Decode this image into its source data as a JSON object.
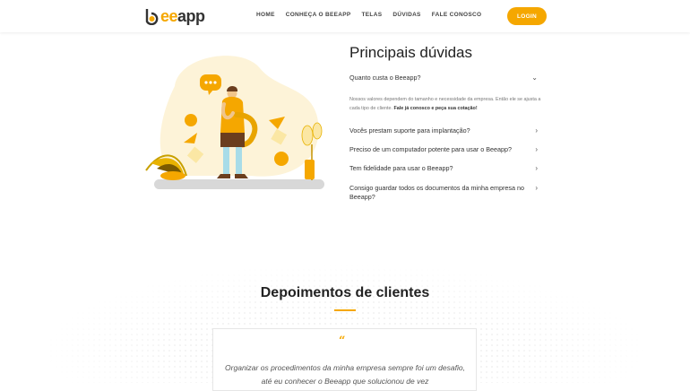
{
  "nav": {
    "brand_ee": "ee",
    "brand_app": "app",
    "links": [
      "HOME",
      "CONHEÇA O BEEAPP",
      "TELAS",
      "DÚVIDAS",
      "FALE CONOSCO"
    ],
    "login": "LOGIN"
  },
  "faq": {
    "title": "Principais dúvidas",
    "q1": "Quanto custa o Beeapp?",
    "answer_text": "Nossos valores dependem do tamanho e necessidade da empresa. Então ele se ajusta a cada tipo de cliente.",
    "answer_bold": "Fale já conosco e peça sua cotação!",
    "q2": "Vocês prestam suporte para implantação?",
    "q3": "Preciso de um computador potente para usar o Beeapp?",
    "q4": "Tem fidelidade para usar o Beeapp?",
    "q5": "Consigo guardar todos os documentos da minha empresa no Beeapp?"
  },
  "depoimentos": {
    "title": "Depoimentos de clientes",
    "quote_mark": "“",
    "text": "Organizar os procedimentos da minha empresa sempre foi um desafio, até eu conhecer o Beeapp que solucionou de vez"
  },
  "colors": {
    "accent": "#f5a700"
  }
}
